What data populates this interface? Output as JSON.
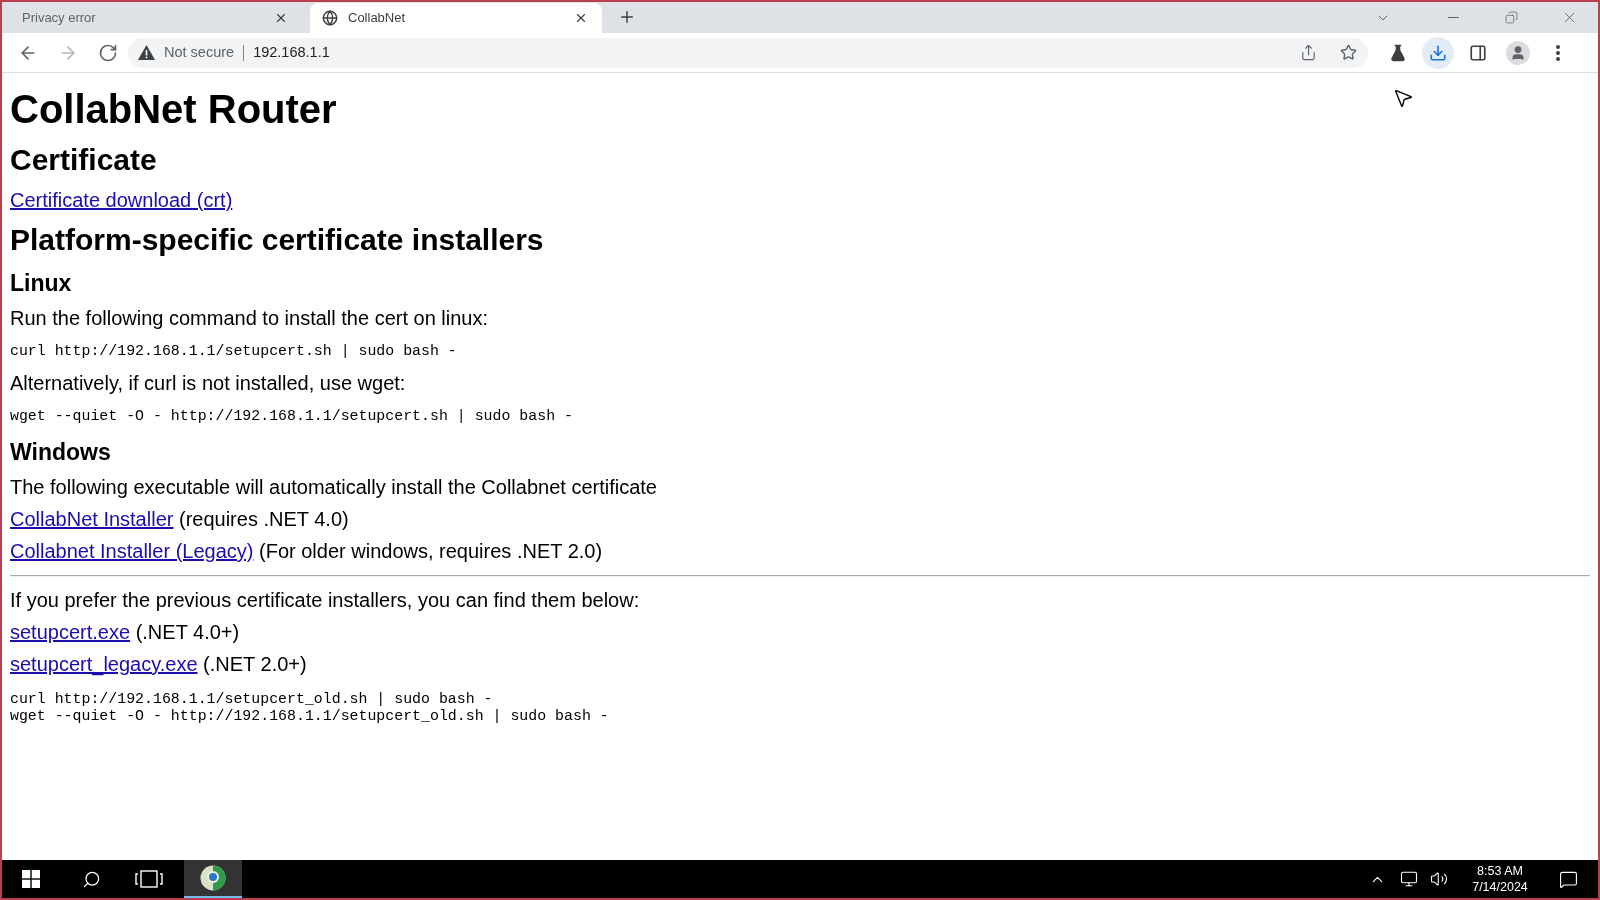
{
  "browser": {
    "tabs": [
      {
        "title": "Privacy error",
        "selected": false
      },
      {
        "title": "CollabNet",
        "selected": true
      }
    ],
    "navigation": {
      "back_disabled": false,
      "forward_disabled": true
    },
    "address_bar": {
      "security": "Not secure",
      "url": "192.168.1.1"
    }
  },
  "page": {
    "blocks": [
      {
        "kind": "h1",
        "text": "CollabNet Router"
      },
      {
        "kind": "h2",
        "text": "Certificate"
      },
      {
        "kind": "link",
        "link": "Certificate download (crt)"
      },
      {
        "kind": "h2",
        "text": "Platform-specific certificate installers"
      },
      {
        "kind": "h3",
        "text": "Linux"
      },
      {
        "kind": "paragraph",
        "text": "Run the following command to install the cert on linux:"
      },
      {
        "kind": "code",
        "lines": [
          "curl http://192.168.1.1/setupcert.sh | sudo bash -"
        ]
      },
      {
        "kind": "paragraph",
        "text": "Alternatively, if curl is not installed, use wget:"
      },
      {
        "kind": "code",
        "lines": [
          "wget --quiet -O - http://192.168.1.1/setupcert.sh | sudo bash -"
        ]
      },
      {
        "kind": "h3",
        "text": "Windows"
      },
      {
        "kind": "paragraph",
        "text": "The following executable will automatically install the Collabnet certificate"
      },
      {
        "kind": "link",
        "link": "CollabNet Installer",
        "note": "(requires .NET 4.0)"
      },
      {
        "kind": "link",
        "link": "Collabnet Installer (Legacy)",
        "note": "(For older windows, requires .NET 2.0)"
      },
      {
        "kind": "rule"
      },
      {
        "kind": "paragraph",
        "text": "If you prefer the previous certificate installers, you can find them below:"
      },
      {
        "kind": "link",
        "link": "setupcert.exe",
        "note": "(.NET 4.0+)"
      },
      {
        "kind": "link",
        "link": "setupcert_legacy.exe",
        "note": "(.NET 2.0+)"
      },
      {
        "kind": "code",
        "lines": [
          "curl http://192.168.1.1/setupcert_old.sh | sudo bash -",
          "wget --quiet -O - http://192.168.1.1/setupcert_old.sh | sudo bash -"
        ]
      }
    ]
  },
  "taskbar": {
    "apps": [
      {
        "kind": "browser",
        "active": true
      }
    ],
    "time": "8:53 AM",
    "date": "7/14/2024"
  }
}
